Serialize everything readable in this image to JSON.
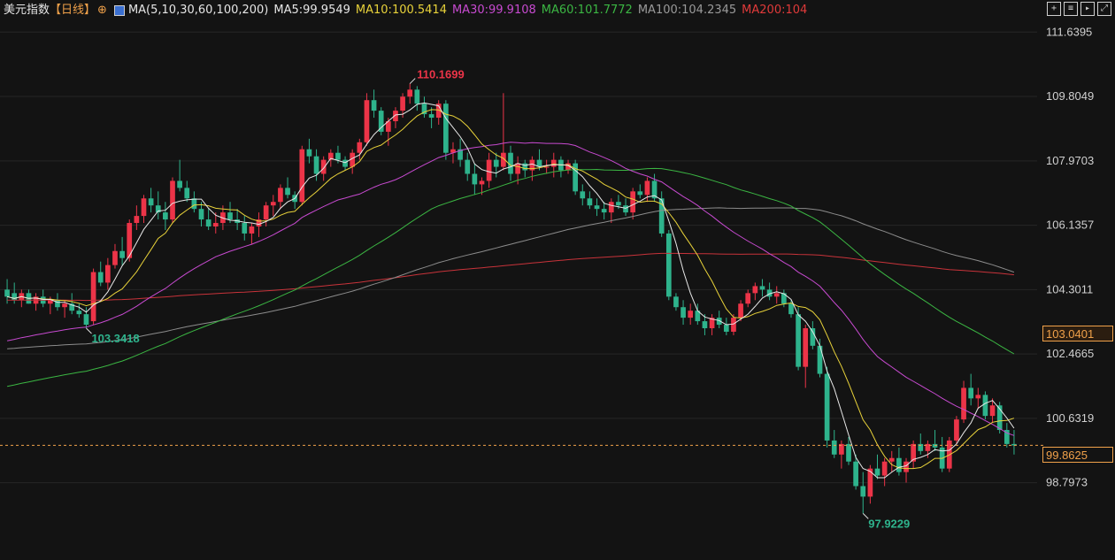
{
  "legend": {
    "name": "美元指数",
    "period": "【日线】",
    "ma_label": "MA(5,10,30,60,100,200)",
    "ma5": "MA5:99.9549",
    "ma10": "MA10:100.5414",
    "ma30": "MA30:99.9108",
    "ma60": "MA60:101.7772",
    "ma100": "MA100:104.2345",
    "ma200": "MA200:104"
  },
  "colors": {
    "up": "#ec3448",
    "down": "#2eb38c",
    "ma5": "#e8e8e8",
    "ma10": "#e8d23a",
    "ma30": "#c74ad0",
    "ma60": "#3bb643",
    "ma100": "#8c8c8c",
    "ma200": "#c8333a",
    "grid": "#262626",
    "axis_text": "#d0d0d0",
    "current": "#f0a14a"
  },
  "tools": [
    "plus-square-icon",
    "bar-chart-icon",
    "play-icon",
    "expand-icon"
  ],
  "price_tags": {
    "highlight": "103.0401",
    "current": "99.8625"
  },
  "chart_data": {
    "type": "candlestick",
    "ylim": [
      97.3,
      112.0
    ],
    "y_ticks": [
      "111.6395",
      "109.8049",
      "107.9703",
      "106.1357",
      "104.3011",
      "102.4665",
      "100.6319",
      "98.7973"
    ],
    "annotations": {
      "high": "110.1699",
      "low": "97.9229",
      "local_low": "103.3418"
    },
    "ohlc": [
      [
        104.3,
        104.6,
        103.9,
        104.1
      ],
      [
        104.2,
        104.5,
        103.9,
        104.0
      ],
      [
        104.0,
        104.3,
        103.8,
        104.2
      ],
      [
        104.2,
        104.3,
        103.9,
        103.9
      ],
      [
        103.9,
        104.2,
        103.7,
        104.1
      ],
      [
        104.1,
        104.3,
        103.8,
        103.9
      ],
      [
        103.9,
        104.1,
        103.6,
        104.0
      ],
      [
        104.0,
        104.2,
        103.7,
        103.8
      ],
      [
        103.8,
        104.0,
        103.5,
        103.9
      ],
      [
        103.9,
        104.2,
        103.6,
        103.7
      ],
      [
        103.7,
        103.9,
        103.5,
        103.6
      ],
      [
        103.6,
        103.8,
        103.2,
        103.3
      ],
      [
        103.4,
        104.9,
        103.3,
        104.8
      ],
      [
        104.8,
        105.1,
        104.4,
        104.5
      ],
      [
        104.5,
        105.2,
        104.3,
        105.0
      ],
      [
        105.0,
        105.6,
        104.9,
        105.4
      ],
      [
        105.4,
        105.8,
        105.0,
        105.2
      ],
      [
        105.2,
        106.3,
        105.1,
        106.2
      ],
      [
        106.2,
        106.7,
        106.0,
        106.4
      ],
      [
        106.4,
        107.0,
        106.2,
        106.9
      ],
      [
        106.9,
        107.2,
        106.5,
        106.7
      ],
      [
        106.7,
        107.1,
        106.3,
        106.5
      ],
      [
        106.5,
        106.8,
        106.0,
        106.3
      ],
      [
        106.3,
        107.5,
        106.2,
        107.4
      ],
      [
        107.4,
        108.0,
        107.1,
        107.2
      ],
      [
        107.2,
        107.4,
        106.8,
        106.9
      ],
      [
        106.9,
        107.1,
        106.5,
        106.6
      ],
      [
        106.6,
        106.8,
        106.1,
        106.3
      ],
      [
        106.3,
        106.6,
        106.0,
        106.1
      ],
      [
        106.1,
        106.5,
        105.9,
        106.2
      ],
      [
        106.2,
        106.7,
        106.0,
        106.5
      ],
      [
        106.5,
        106.8,
        106.2,
        106.3
      ],
      [
        106.3,
        106.6,
        106.0,
        106.2
      ],
      [
        106.2,
        106.4,
        105.7,
        105.9
      ],
      [
        105.9,
        106.2,
        105.6,
        106.1
      ],
      [
        106.1,
        106.5,
        105.8,
        106.3
      ],
      [
        106.3,
        106.8,
        106.1,
        106.7
      ],
      [
        106.7,
        107.0,
        106.4,
        106.8
      ],
      [
        106.8,
        107.3,
        106.6,
        107.2
      ],
      [
        107.2,
        107.5,
        106.9,
        107.0
      ],
      [
        107.0,
        107.1,
        106.6,
        106.8
      ],
      [
        106.8,
        108.4,
        106.7,
        108.3
      ],
      [
        108.3,
        108.6,
        107.9,
        108.1
      ],
      [
        108.1,
        108.3,
        107.4,
        107.6
      ],
      [
        107.6,
        108.1,
        107.4,
        108.0
      ],
      [
        108.0,
        108.3,
        107.8,
        108.2
      ],
      [
        108.2,
        108.4,
        107.9,
        108.0
      ],
      [
        108.0,
        108.1,
        107.7,
        107.8
      ],
      [
        107.8,
        108.3,
        107.6,
        108.2
      ],
      [
        108.2,
        108.6,
        108.0,
        108.5
      ],
      [
        108.5,
        109.9,
        108.4,
        109.7
      ],
      [
        109.7,
        110.0,
        109.2,
        109.4
      ],
      [
        109.4,
        109.5,
        108.7,
        108.8
      ],
      [
        108.8,
        109.2,
        108.4,
        109.1
      ],
      [
        109.1,
        109.5,
        108.9,
        109.4
      ],
      [
        109.4,
        109.9,
        109.2,
        109.8
      ],
      [
        109.8,
        110.17,
        109.6,
        110.0
      ],
      [
        110.0,
        110.1,
        109.4,
        109.6
      ],
      [
        109.6,
        109.8,
        109.2,
        109.3
      ],
      [
        109.3,
        109.5,
        108.9,
        109.2
      ],
      [
        109.2,
        109.7,
        109.0,
        109.6
      ],
      [
        109.6,
        109.7,
        108.0,
        108.2
      ],
      [
        108.2,
        108.5,
        107.9,
        108.3
      ],
      [
        108.3,
        108.6,
        107.8,
        108.0
      ],
      [
        108.0,
        108.2,
        107.4,
        107.6
      ],
      [
        107.6,
        107.9,
        107.0,
        107.3
      ],
      [
        107.3,
        107.5,
        107.0,
        107.4
      ],
      [
        107.4,
        108.2,
        107.2,
        108.0
      ],
      [
        108.0,
        108.2,
        107.5,
        107.8
      ],
      [
        107.8,
        109.9,
        107.7,
        108.2
      ],
      [
        108.2,
        108.4,
        107.4,
        107.6
      ],
      [
        107.6,
        108.1,
        107.3,
        107.9
      ],
      [
        107.9,
        108.0,
        107.5,
        107.7
      ],
      [
        107.7,
        108.1,
        107.4,
        108.0
      ],
      [
        108.0,
        108.3,
        107.7,
        107.8
      ],
      [
        107.8,
        108.0,
        107.6,
        107.8
      ],
      [
        107.8,
        108.2,
        107.5,
        108.0
      ],
      [
        108.0,
        108.1,
        107.5,
        107.7
      ],
      [
        107.7,
        108.0,
        107.6,
        107.9
      ],
      [
        107.9,
        108.0,
        107.0,
        107.1
      ],
      [
        107.1,
        107.3,
        106.7,
        106.9
      ],
      [
        106.9,
        107.1,
        106.6,
        106.7
      ],
      [
        106.7,
        106.9,
        106.4,
        106.6
      ],
      [
        106.6,
        106.8,
        106.3,
        106.5
      ],
      [
        106.5,
        106.9,
        106.2,
        106.8
      ],
      [
        106.8,
        107.0,
        106.6,
        106.7
      ],
      [
        106.7,
        106.9,
        106.4,
        106.5
      ],
      [
        106.5,
        107.2,
        106.3,
        107.1
      ],
      [
        107.1,
        107.3,
        106.9,
        107.0
      ],
      [
        107.0,
        107.5,
        106.8,
        107.4
      ],
      [
        107.4,
        107.6,
        106.8,
        106.9
      ],
      [
        106.9,
        107.1,
        105.8,
        105.9
      ],
      [
        105.9,
        106.0,
        104.0,
        104.1
      ],
      [
        104.1,
        104.2,
        103.7,
        103.8
      ],
      [
        103.8,
        104.0,
        103.3,
        103.5
      ],
      [
        103.5,
        103.9,
        103.3,
        103.7
      ],
      [
        103.7,
        103.9,
        103.3,
        103.4
      ],
      [
        103.4,
        103.6,
        103.0,
        103.2
      ],
      [
        103.2,
        103.6,
        103.0,
        103.5
      ],
      [
        103.5,
        103.7,
        103.2,
        103.3
      ],
      [
        103.3,
        103.5,
        103.0,
        103.1
      ],
      [
        103.1,
        103.6,
        103.0,
        103.5
      ],
      [
        103.5,
        104.0,
        103.4,
        103.9
      ],
      [
        103.9,
        104.3,
        103.8,
        104.2
      ],
      [
        104.2,
        104.5,
        104.0,
        104.4
      ],
      [
        104.4,
        104.6,
        104.1,
        104.3
      ],
      [
        104.3,
        104.5,
        104.0,
        104.1
      ],
      [
        104.1,
        104.4,
        103.9,
        104.2
      ],
      [
        104.2,
        104.3,
        103.8,
        103.9
      ],
      [
        103.9,
        104.0,
        103.5,
        103.6
      ],
      [
        103.6,
        103.8,
        102.0,
        102.1
      ],
      [
        102.1,
        103.3,
        101.5,
        103.2
      ],
      [
        103.2,
        103.4,
        102.6,
        102.7
      ],
      [
        102.7,
        102.9,
        101.8,
        101.9
      ],
      [
        101.9,
        102.1,
        99.8,
        100.0
      ],
      [
        100.0,
        100.3,
        99.5,
        99.6
      ],
      [
        99.6,
        100.0,
        99.2,
        99.9
      ],
      [
        99.9,
        100.1,
        99.3,
        99.4
      ],
      [
        99.4,
        99.6,
        98.6,
        98.7
      ],
      [
        98.7,
        99.1,
        97.92,
        98.4
      ],
      [
        98.4,
        99.3,
        98.2,
        99.2
      ],
      [
        99.2,
        99.6,
        98.9,
        99.0
      ],
      [
        99.0,
        99.5,
        98.7,
        99.4
      ],
      [
        99.4,
        99.7,
        99.1,
        99.5
      ],
      [
        99.5,
        99.8,
        99.0,
        99.1
      ],
      [
        99.1,
        99.5,
        98.8,
        99.4
      ],
      [
        99.4,
        100.0,
        99.2,
        99.9
      ],
      [
        99.9,
        100.2,
        99.6,
        99.7
      ],
      [
        99.7,
        100.0,
        99.5,
        99.9
      ],
      [
        99.9,
        100.3,
        99.7,
        99.8
      ],
      [
        99.8,
        100.1,
        99.1,
        99.2
      ],
      [
        99.2,
        100.1,
        99.1,
        100.0
      ],
      [
        100.0,
        100.7,
        99.9,
        100.6
      ],
      [
        100.6,
        101.7,
        100.5,
        101.5
      ],
      [
        101.5,
        101.9,
        101.0,
        101.2
      ],
      [
        101.2,
        101.5,
        100.9,
        101.3
      ],
      [
        101.3,
        101.4,
        100.6,
        100.7
      ],
      [
        100.7,
        101.2,
        100.5,
        101.0
      ],
      [
        101.0,
        101.1,
        100.2,
        100.3
      ],
      [
        100.3,
        100.5,
        99.8,
        99.9
      ],
      [
        99.9,
        100.3,
        99.6,
        99.86
      ]
    ]
  }
}
